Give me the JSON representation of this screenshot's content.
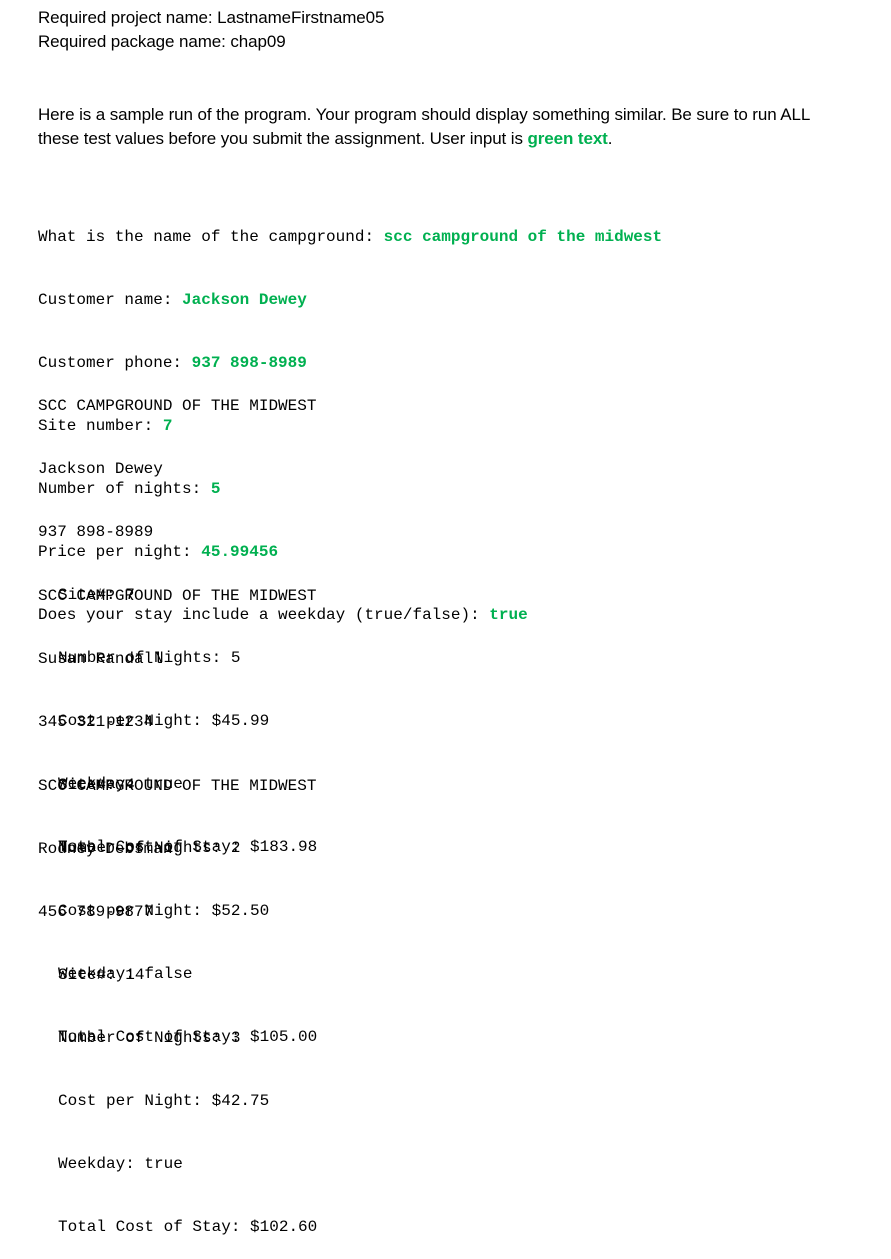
{
  "header": {
    "project_line": "Required project name: LastnameFirstname05",
    "package_line": "Required package name: chap09"
  },
  "intro": {
    "line1": "Here is a sample run of the program. Your program should display something similar. Be sure to run ALL",
    "line2_prefix": "these test values before you submit the assignment. User input is ",
    "line2_green": "green text",
    "line2_suffix": "."
  },
  "prompts": [
    {
      "label": "What is the name of the campground: ",
      "input": "scc campground of the midwest"
    },
    {
      "label": "Customer name: ",
      "input": "Jackson Dewey"
    },
    {
      "label": "Customer phone: ",
      "input": "937 898-8989"
    },
    {
      "label": "Site number: ",
      "input": "7"
    },
    {
      "label": "Number of nights: ",
      "input": "5"
    },
    {
      "label": "Price per night: ",
      "input": "45.99456"
    },
    {
      "label": "Does your stay include a weekday (true/false): ",
      "input": "true"
    }
  ],
  "receipts": [
    {
      "campground": "SCC CAMPGROUND OF THE MIDWEST",
      "name": "Jackson Dewey",
      "phone": "937 898-8989",
      "site": "Site#: 7",
      "nights": "Number of Nights: 5",
      "cost_per_night": "Cost per Night: $45.99",
      "weekday": "Weekday: true",
      "total": "Total Cost of Stay: $183.98"
    },
    {
      "campground": "SCC CAMPGROUND OF THE MIDWEST",
      "name": "Susan Randall",
      "phone": "345 321-1234",
      "site": "Site#: 4",
      "nights": "Number of Nights: 2",
      "cost_per_night": "Cost per Night: $52.50",
      "weekday": "Weekday: false",
      "total": "Total Cost of Stay: $105.00"
    },
    {
      "campground": "SCC CAMPGROUND OF THE MIDWEST",
      "name": "Rodney Debsman",
      "phone": "456 789-9877",
      "site": "Site#: 14",
      "nights": "Number of Nights: 3",
      "cost_per_night": "Cost per Night: $42.75",
      "weekday": "Weekday: true",
      "total": "Total Cost of Stay: $102.60"
    }
  ],
  "colors": {
    "user_input": "#00b050",
    "text": "#000000",
    "background": "#ffffff"
  }
}
